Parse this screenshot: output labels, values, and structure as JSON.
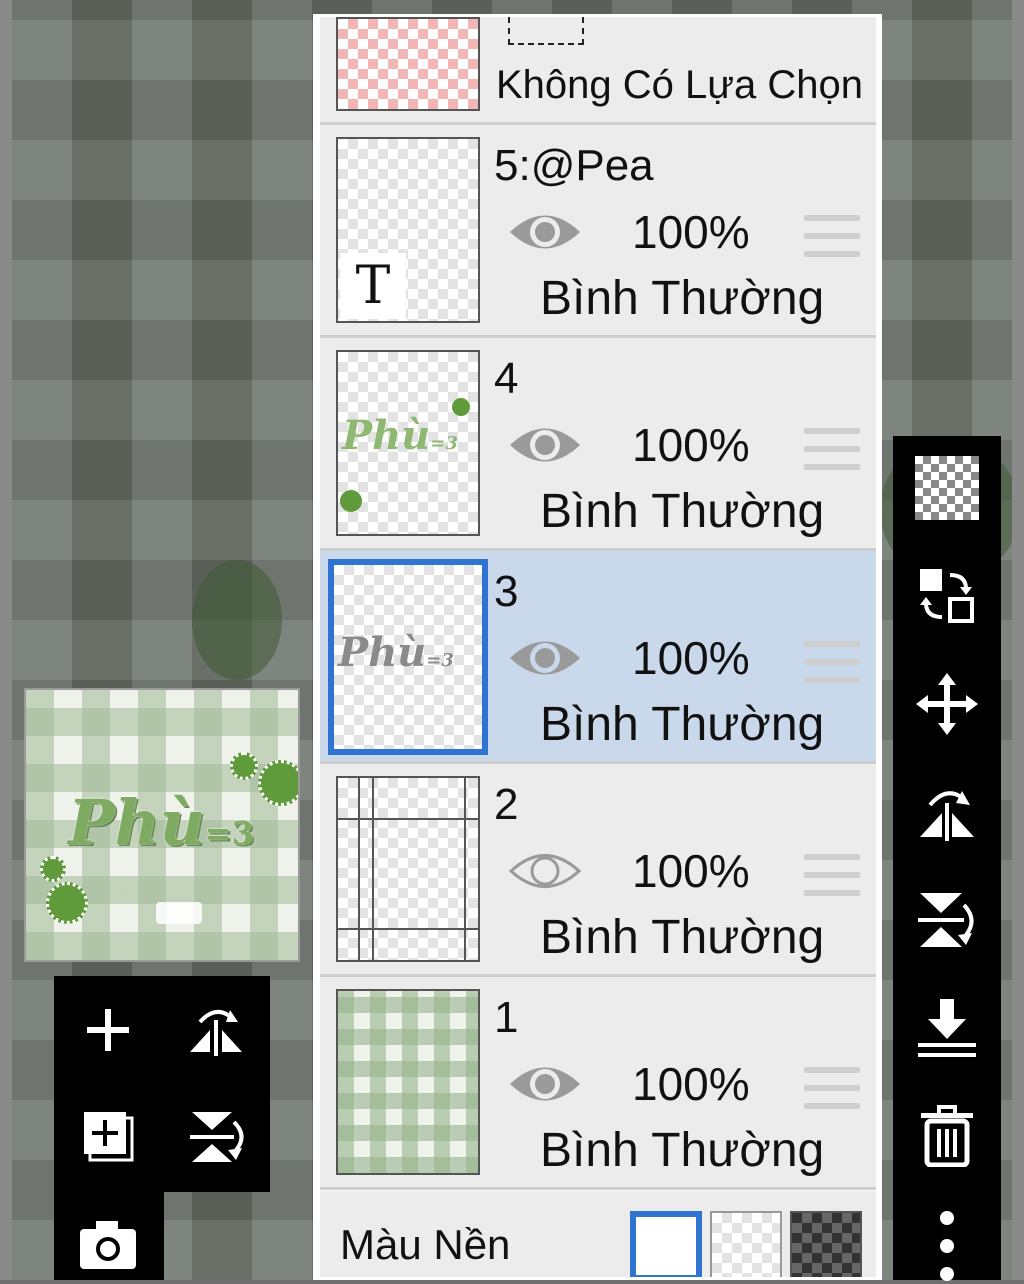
{
  "layers_panel": {
    "top_layer": {
      "label": "Không Có Lựa Chọn"
    },
    "layers": [
      {
        "name": "5:@Pea",
        "opacity": "100%",
        "blend": "Bình Thường",
        "visible": true,
        "selected": false
      },
      {
        "name": "4",
        "opacity": "100%",
        "blend": "Bình Thường",
        "visible": true,
        "selected": false
      },
      {
        "name": "3",
        "opacity": "100%",
        "blend": "Bình Thường",
        "visible": true,
        "selected": true
      },
      {
        "name": "2",
        "opacity": "100%",
        "blend": "Bình Thường",
        "visible": false,
        "selected": false
      },
      {
        "name": "1",
        "opacity": "100%",
        "blend": "Bình Thường",
        "visible": true,
        "selected": false
      }
    ],
    "background": {
      "label": "Màu Nền",
      "options": [
        "white",
        "transparent",
        "dark-checker"
      ],
      "selected": "white"
    }
  },
  "thumbnails": {
    "layer5_text_icon": "T",
    "layer_art_text": "Phù",
    "layer_art_suffix": "=3"
  },
  "preview": {
    "art_text": "Phù",
    "art_suffix": "=3"
  },
  "colors": {
    "selected_row": "#cad8ec",
    "selected_border": "#2f74d0",
    "accent_green": "#7faa62"
  },
  "left_tools": [
    "add-layer-icon",
    "flip-horizontal-icon",
    "duplicate-layer-icon",
    "flip-vertical-icon",
    "camera-icon"
  ],
  "right_tools": [
    "transparent-icon",
    "swap-icon",
    "move-icon",
    "flip-horizontal-icon",
    "flip-vertical-icon",
    "merge-down-icon",
    "trash-icon",
    "more-icon"
  ]
}
